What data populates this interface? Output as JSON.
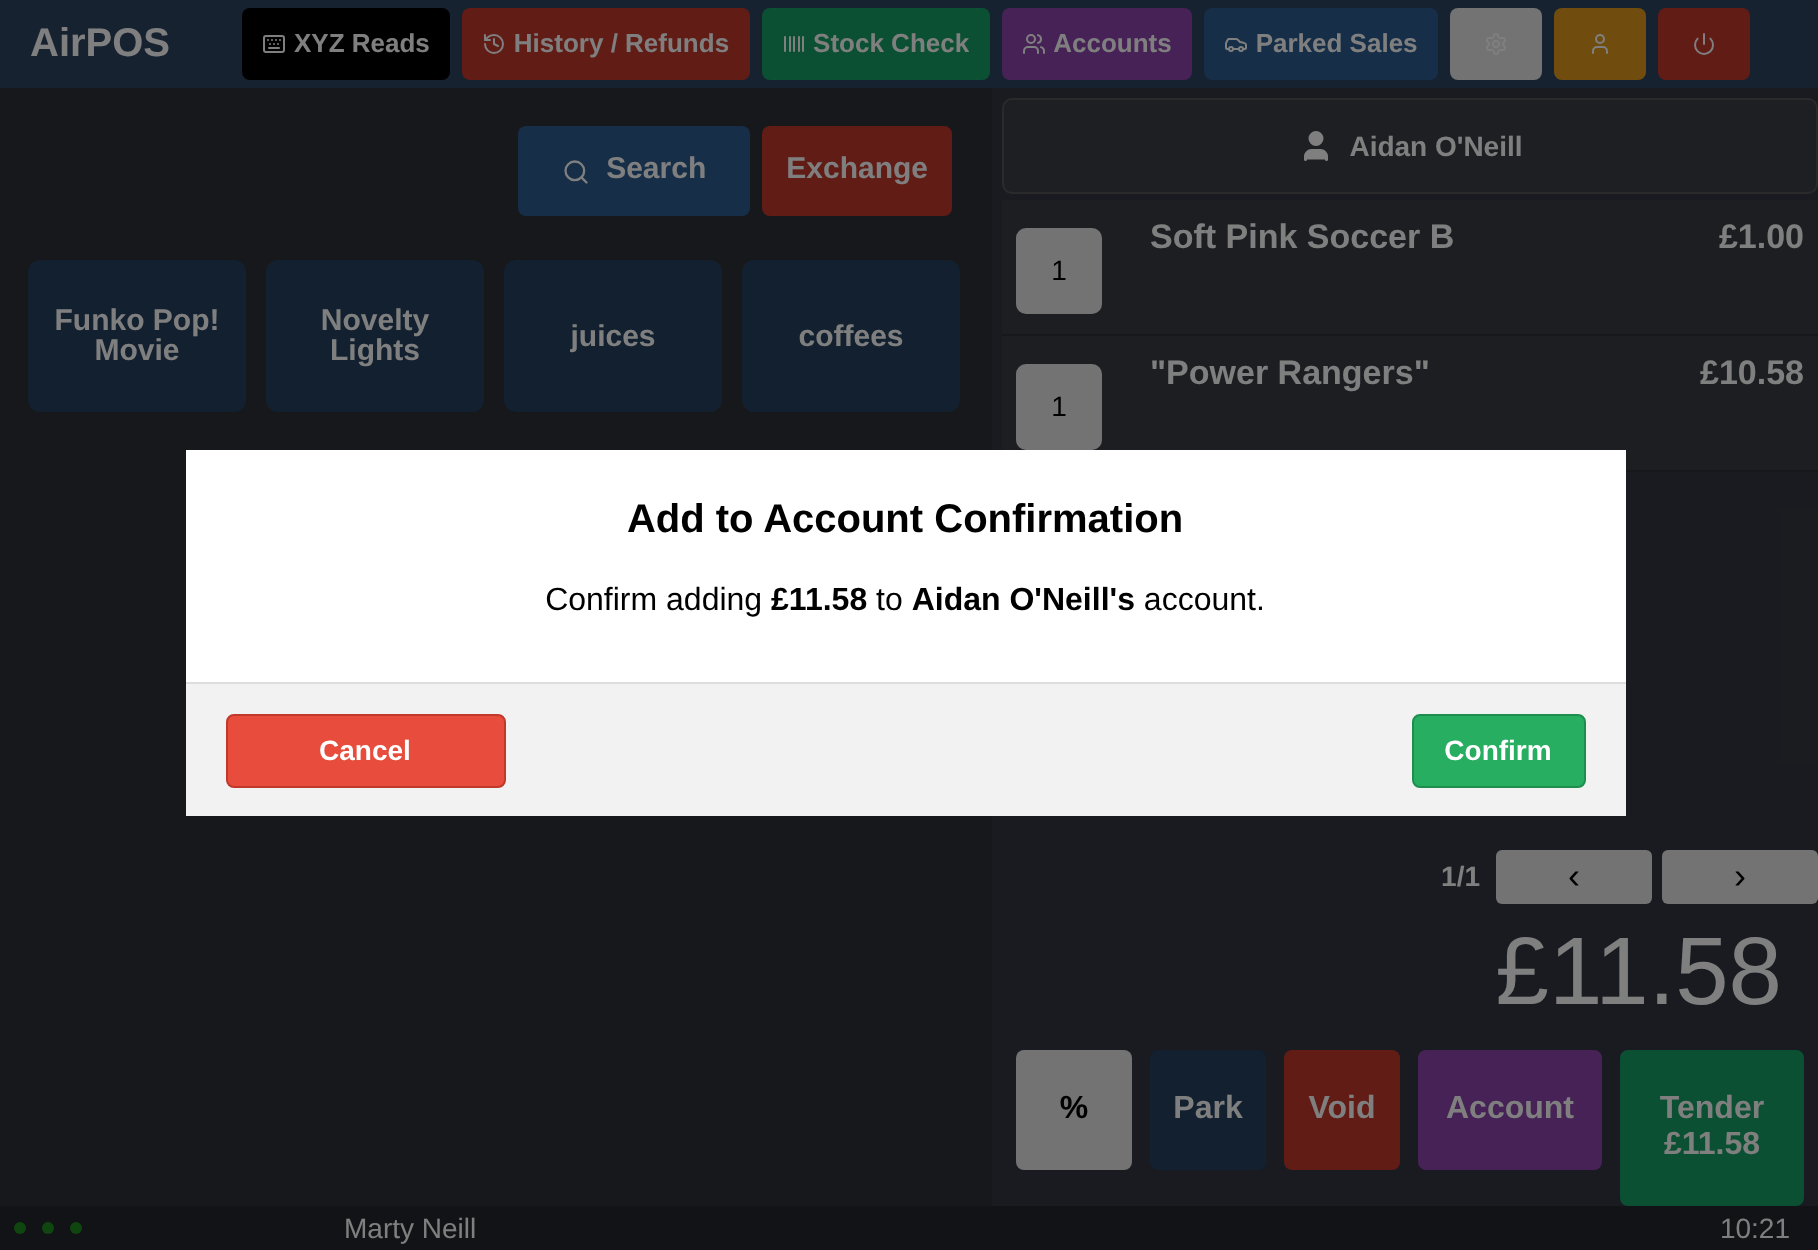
{
  "app": {
    "title": "AirPOS"
  },
  "nav": [
    {
      "label": "XYZ Reads",
      "kind": "reads"
    },
    {
      "label": "History / Refunds",
      "kind": "history"
    },
    {
      "label": "Stock Check",
      "kind": "stock"
    },
    {
      "label": "Accounts",
      "kind": "accounts"
    },
    {
      "label": "Parked Sales",
      "kind": "parked"
    },
    {
      "kind": "settings"
    },
    {
      "kind": "user"
    },
    {
      "kind": "power"
    }
  ],
  "search_button": "Search",
  "exchange_button": "Exchange",
  "categories": [
    "Funko Pop! Movie",
    "Novelty Lights",
    "juices",
    "coffees"
  ],
  "customer": "Aidan O'Neill",
  "sale_items": [
    {
      "qty": "1",
      "name": "Soft Pink Soccer B",
      "price": "£1.00"
    },
    {
      "qty": "1",
      "name": "\"Power Rangers\"",
      "price": "£10.58"
    }
  ],
  "pagination": "1/1",
  "prev_button": "‹",
  "next_button": "›",
  "total": "£11.58",
  "actions": [
    {
      "label": "%",
      "kind": "discount"
    },
    {
      "label": "Park",
      "kind": "park"
    },
    {
      "label": "Void",
      "kind": "void"
    },
    {
      "label": "Account",
      "kind": "account"
    },
    {
      "label": "Tender £11.58",
      "kind": "tender"
    }
  ],
  "footer": {
    "user": "Marty Neill",
    "time": "10:21"
  },
  "dialog": {
    "title": "Add to Account Confirmation",
    "message": "Confirm adding **£11.58** to **Aidan O'Neill's** account.",
    "cancel": "Cancel",
    "confirm": "Confirm"
  }
}
